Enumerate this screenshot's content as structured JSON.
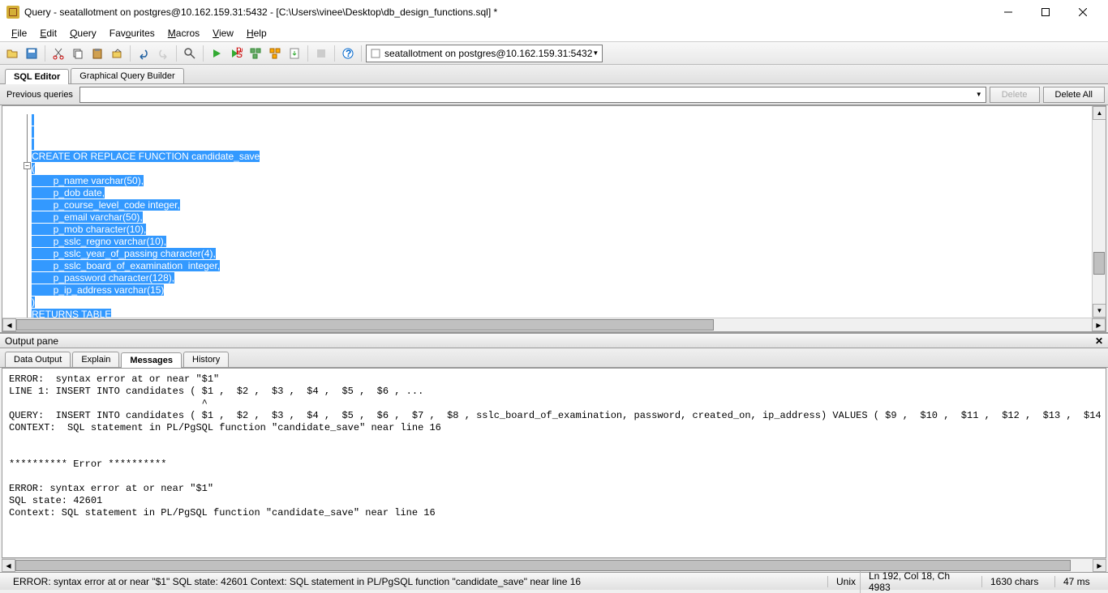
{
  "titlebar": {
    "title": "Query - seatallotment on postgres@10.162.159.31:5432 - [C:\\Users\\vinee\\Desktop\\db_design_functions.sql] *"
  },
  "menu": {
    "file": "File",
    "edit": "Edit",
    "query": "Query",
    "favourites": "Favourites",
    "macros": "Macros",
    "view": "View",
    "help": "Help"
  },
  "toolbar": {
    "connection": "seatallotment on postgres@10.162.159.31:5432"
  },
  "tabs": {
    "sql_editor": "SQL Editor",
    "graphical": "Graphical Query Builder"
  },
  "prev_queries": {
    "label": "Previous queries",
    "delete": "Delete",
    "delete_all": "Delete All"
  },
  "code": {
    "lines": [
      "",
      "",
      "",
      "CREATE OR REPLACE FUNCTION candidate_save",
      "(",
      "        p_name varchar(50),",
      "        p_dob date,",
      "        p_course_level_code integer,",
      "        p_email varchar(50),",
      "        p_mob character(10),",
      "        p_sslc_regno varchar(10),",
      "        p_sslc_year_of_passing character(4),",
      "        p_sslc_board_of_examination  integer,",
      "        p_password character(128),",
      "        p_ip_address varchar(15)",
      ")",
      "RETURNS TABLE",
      "("
    ]
  },
  "output": {
    "header": "Output pane",
    "tabs": {
      "data_output": "Data Output",
      "explain": "Explain",
      "messages": "Messages",
      "history": "History"
    },
    "messages": "ERROR:  syntax error at or near \"$1\"\nLINE 1: INSERT INTO candidates ( $1 ,  $2 ,  $3 ,  $4 ,  $5 ,  $6 , ...\n                                 ^\nQUERY:  INSERT INTO candidates ( $1 ,  $2 ,  $3 ,  $4 ,  $5 ,  $6 ,  $7 ,  $8 , sslc_board_of_examination, password, created_on, ip_address) VALUES ( $9 ,  $10 ,  $11 ,  $12 ,  $13 ,  $14 ,\nCONTEXT:  SQL statement in PL/PgSQL function \"candidate_save\" near line 16\n\n\n********** Error **********\n\nERROR: syntax error at or near \"$1\"\nSQL state: 42601\nContext: SQL statement in PL/PgSQL function \"candidate_save\" near line 16"
  },
  "status": {
    "error": "ERROR: syntax error at or near \"$1\" SQL state: 42601 Context: SQL statement in PL/PgSQL function \"candidate_save\" near line 16",
    "os": "Unix",
    "pos": "Ln 192, Col 18, Ch 4983",
    "chars": "1630 chars",
    "time": "47 ms"
  },
  "icons": {
    "open": "open",
    "save": "save",
    "cut": "cut",
    "copy": "copy",
    "paste": "paste",
    "clear": "clear",
    "undo": "undo",
    "redo": "redo",
    "find": "find",
    "run": "run",
    "pgscript": "pgscript",
    "explain": "explain",
    "stop": "stop",
    "savefile": "savefile",
    "cancel": "cancel",
    "help": "help"
  }
}
